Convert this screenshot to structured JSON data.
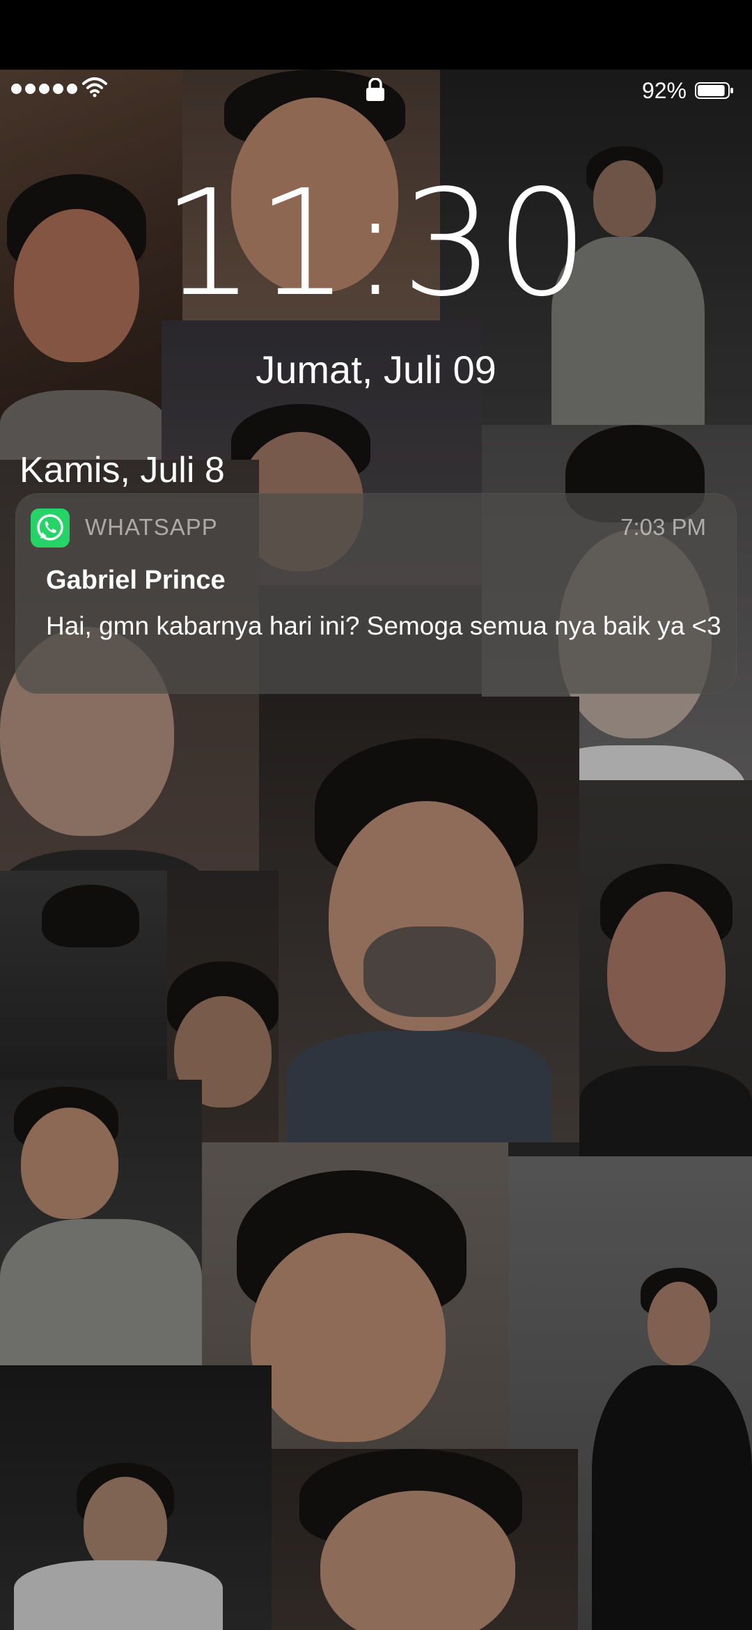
{
  "status_bar": {
    "signal_dots": 5,
    "battery_percent": "92%",
    "battery_level": 0.92,
    "icons": [
      "signal-dots",
      "wifi-icon",
      "lock-icon",
      "battery-icon"
    ]
  },
  "lock_screen": {
    "time": "11:30",
    "date": "Jumat, Juli 09"
  },
  "notifications": {
    "section_date": "Kamis, Juli 8",
    "items": [
      {
        "app_name": "WHATSAPP",
        "app_icon": "whatsapp-icon",
        "app_color": "#25d366",
        "time": "7:03 PM",
        "sender": "Gabriel Prince",
        "message": "Hai, gmn kabarnya hari ini? Semoga semua nya baik ya <3"
      }
    ]
  },
  "colors": {
    "background": "#000000",
    "notification_bg": "rgba(78,76,74,0.72)",
    "text": "#ffffff",
    "muted_text": "rgba(255,255,255,0.55)"
  }
}
